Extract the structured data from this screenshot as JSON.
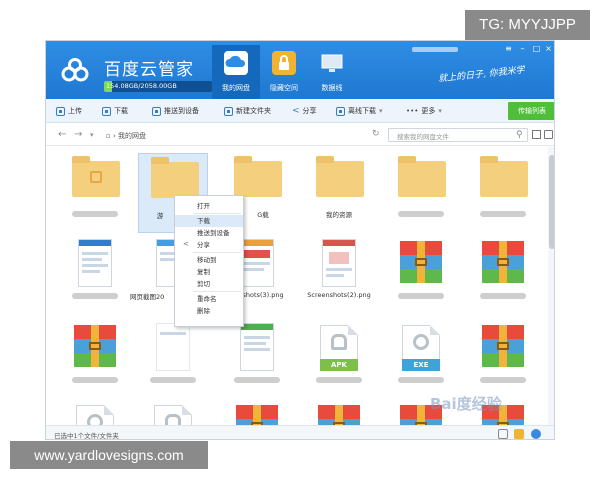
{
  "watermarks": {
    "top_right": "TG: MYYJJPP",
    "bottom_left": "www.yardlovesigns.com",
    "baidu": "Bai度经验"
  },
  "app": {
    "title": "百度云管家",
    "quota_text": "154.08GB/2058.00GB",
    "quota_used_fraction": 0.075,
    "slogan": "就上的日子, 你我米学"
  },
  "nav": [
    {
      "label": "我的网盘",
      "icon": "cloud-drive-icon",
      "color": "#ffffff"
    },
    {
      "label": "隐藏空间",
      "icon": "lock-icon",
      "color": "#f2b233"
    },
    {
      "label": "数据线",
      "icon": "monitor-icon",
      "color": "#dfeaf5"
    }
  ],
  "toolbar": {
    "upload": "上传",
    "download": "下载",
    "push": "推送到设备",
    "new_folder": "新建文件夹",
    "share": "分享",
    "offline": "离线下载",
    "more": "更多",
    "transfer": "传输列表"
  },
  "address": {
    "path": "我的网盘",
    "search_placeholder": "搜索我的网盘文件"
  },
  "files": {
    "row1_captions": [
      "",
      "游",
      "G载",
      "我的资源",
      "",
      ""
    ],
    "row2_captions": [
      "",
      "网页截图20",
      "enshots(3).png",
      "Screenshots(2).png",
      "",
      ""
    ],
    "apk_tag": "APK",
    "exe_tag": "EXE"
  },
  "context_menu": [
    "打开",
    "下载",
    "推送到设备",
    "分享",
    "移动到",
    "复制",
    "剪切",
    "重命名",
    "删除"
  ],
  "status": {
    "text": "已选中1个文件/文件夹"
  }
}
